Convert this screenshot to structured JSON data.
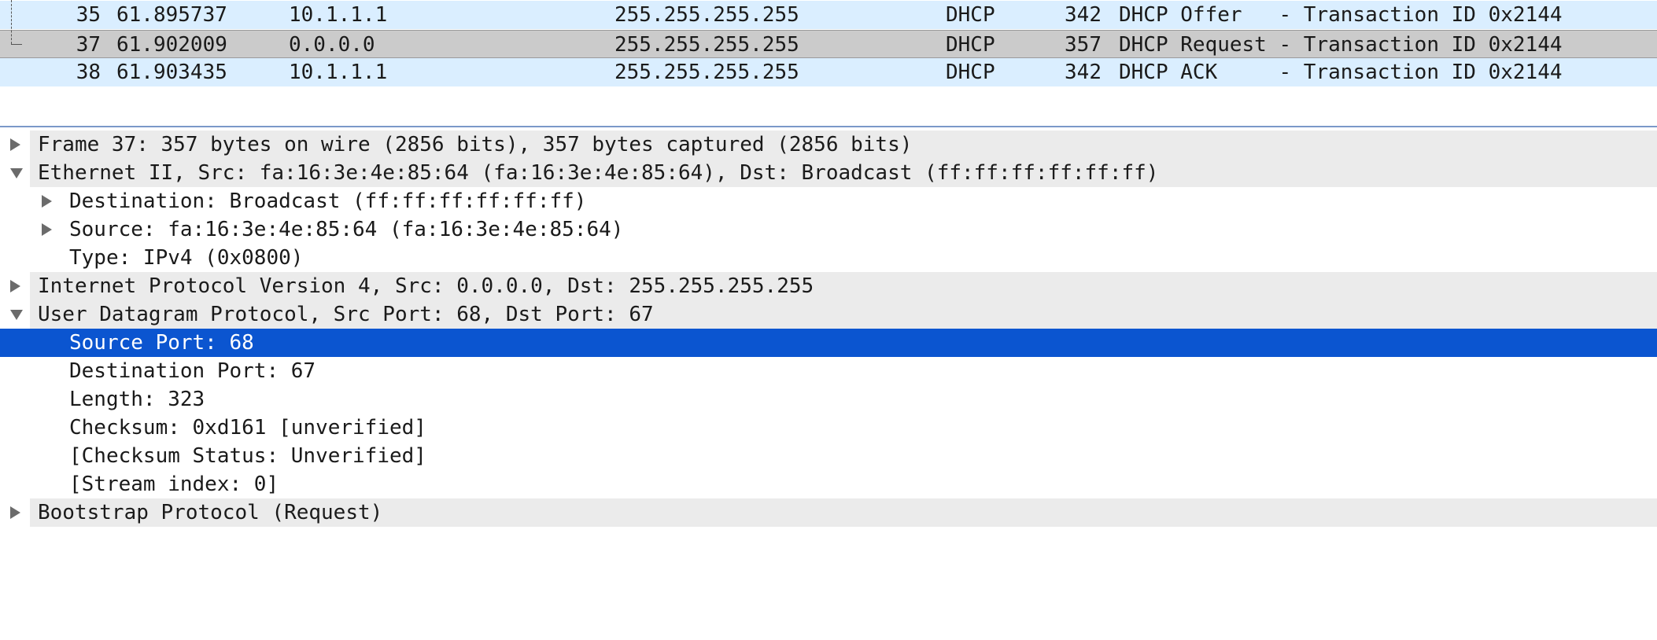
{
  "packet_list": {
    "rows": [
      {
        "no": "35",
        "time": "61.895737",
        "src": "10.1.1.1",
        "dst": "255.255.255.255",
        "proto": "DHCP",
        "len": "342",
        "info": "DHCP Offer   - Transaction ID 0x2144"
      },
      {
        "no": "37",
        "time": "61.902009",
        "src": "0.0.0.0",
        "dst": "255.255.255.255",
        "proto": "DHCP",
        "len": "357",
        "info": "DHCP Request - Transaction ID 0x2144"
      },
      {
        "no": "38",
        "time": "61.903435",
        "src": "10.1.1.1",
        "dst": "255.255.255.255",
        "proto": "DHCP",
        "len": "342",
        "info": "DHCP ACK     - Transaction ID 0x2144"
      }
    ]
  },
  "details": {
    "frame": "Frame 37: 357 bytes on wire (2856 bits), 357 bytes captured (2856 bits)",
    "ethernet": "Ethernet II, Src: fa:16:3e:4e:85:64 (fa:16:3e:4e:85:64), Dst: Broadcast (ff:ff:ff:ff:ff:ff)",
    "eth_destination": "Destination: Broadcast (ff:ff:ff:ff:ff:ff)",
    "eth_source": "Source: fa:16:3e:4e:85:64 (fa:16:3e:4e:85:64)",
    "eth_type": "Type: IPv4 (0x0800)",
    "ipv4": "Internet Protocol Version 4, Src: 0.0.0.0, Dst: 255.255.255.255",
    "udp": "User Datagram Protocol, Src Port: 68, Dst Port: 67",
    "udp_src_port": "Source Port: 68",
    "udp_dst_port": "Destination Port: 67",
    "udp_length": "Length: 323",
    "udp_checksum": "Checksum: 0xd161 [unverified]",
    "udp_checksum_status": "[Checksum Status: Unverified]",
    "udp_stream_index": "[Stream index: 0]",
    "bootp": "Bootstrap Protocol (Request)"
  },
  "colors": {
    "dhcp_row": "#daeeff",
    "selected_packet": "#cbcbcb",
    "selected_field": "#0b55d0"
  }
}
